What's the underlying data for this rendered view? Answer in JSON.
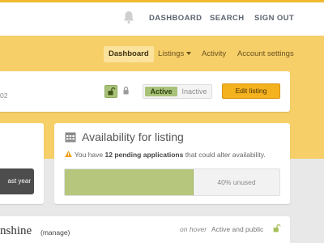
{
  "topnav": {
    "bell_icon": "bell-icon",
    "items": [
      "DASHBOARD",
      "SEARCH",
      "SIGN OUT"
    ]
  },
  "subnav": {
    "items": [
      "Dashboard",
      "Listings",
      "Activity",
      "Account settings"
    ],
    "active": "Dashboard"
  },
  "listing_card": {
    "date_fragment": "02",
    "lock_icons": [
      "unlock-icon",
      "lock-icon"
    ],
    "status_toggle": {
      "on_label": "Active",
      "off_label": "Inactive",
      "selected": "Active"
    },
    "edit_label": "Edit listing"
  },
  "left_card": {
    "button_label": "ast year"
  },
  "availability": {
    "title": "Availability for listing",
    "icon": "calendar-icon",
    "warning_icon": "warning-icon",
    "warning_pre": "You have ",
    "warning_bold": "12 pending applications",
    "warning_post": " that could alter availability.",
    "used_fraction": 0.6,
    "unused_label": "40% unused"
  },
  "bottom_listing": {
    "name": "nshine",
    "manage_label": "(manage)",
    "hover_label": "on hover",
    "status_label": "Active and public",
    "lock_icon": "unlock-icon"
  },
  "colors": {
    "accent": "#f6cf68",
    "active_green": "#a9c27a",
    "button_orange": "#f4b21e"
  }
}
